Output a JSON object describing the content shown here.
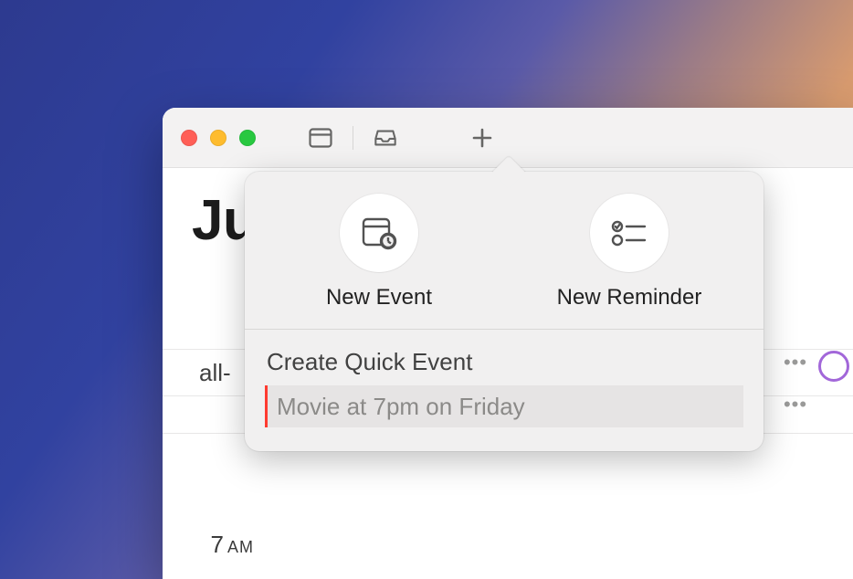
{
  "header": {
    "month_fragment": "Ju"
  },
  "toolbar": {},
  "calendar": {
    "allday_label": "all-",
    "time_slot": {
      "hour": "7",
      "ampm": "AM"
    }
  },
  "popover": {
    "new_event_label": "New Event",
    "new_reminder_label": "New Reminder",
    "quick_event_header": "Create Quick Event",
    "quick_event_placeholder": "Movie at 7pm on Friday"
  }
}
